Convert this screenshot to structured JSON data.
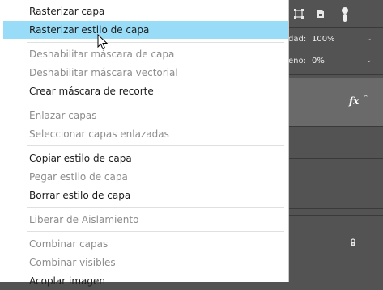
{
  "menu": {
    "items": [
      {
        "label": "Rasterizar capa",
        "enabled": true
      },
      {
        "label": "Rasterizar estilo de capa",
        "enabled": true,
        "highlighted": true
      },
      {
        "label": "Deshabilitar máscara de capa",
        "enabled": false
      },
      {
        "label": "Deshabilitar máscara vectorial",
        "enabled": false
      },
      {
        "label": "Crear máscara de recorte",
        "enabled": true
      },
      {
        "label": "Enlazar capas",
        "enabled": false
      },
      {
        "label": "Seleccionar capas enlazadas",
        "enabled": false
      },
      {
        "label": "Copiar estilo de capa",
        "enabled": true
      },
      {
        "label": "Pegar estilo de capa",
        "enabled": false
      },
      {
        "label": "Borrar estilo de capa",
        "enabled": true
      },
      {
        "label": "Liberar de Aislamiento",
        "enabled": false
      },
      {
        "label": "Combinar capas",
        "enabled": false
      },
      {
        "label": "Combinar visibles",
        "enabled": false
      },
      {
        "label": "Acoplar imagen",
        "enabled": true
      }
    ]
  },
  "panel": {
    "opacity_label": "dad:",
    "opacity_value": "100%",
    "fill_label": "eno:",
    "fill_value": "0%",
    "fx_label": "fx",
    "icons": [
      "transform-icon",
      "lock-file-icon",
      "toggle-icon",
      "lock-icon"
    ]
  },
  "colors": {
    "highlight": "#99dcf7",
    "panel": "#535353",
    "selected_layer": "#6a6a6a"
  }
}
